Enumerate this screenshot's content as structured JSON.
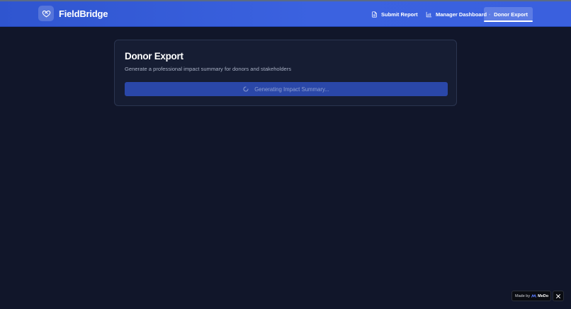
{
  "app": {
    "brand_name": "FieldBridge",
    "brand_icon": "heart-handshake-icon"
  },
  "nav": {
    "items": [
      {
        "label": "Submit Report",
        "icon": "document-icon",
        "active": false
      },
      {
        "label": "Manager Dashboard",
        "icon": "bar-chart-icon",
        "active": false
      },
      {
        "label": "Donor Export",
        "icon": "heart-handshake-icon",
        "active": true
      }
    ]
  },
  "main": {
    "title": "Donor Export",
    "subtitle": "Generate a professional impact summary for donors and stakeholders",
    "generate_button": {
      "label": "Generating Impact Summary...",
      "state": "loading",
      "icon": "spinner-icon"
    }
  },
  "badge": {
    "made_by_label": "Made by",
    "made_by_brand": "MeDo",
    "close_icon": "close-icon"
  },
  "colors": {
    "header_start": "#2f55cf",
    "header_end": "#3a60de",
    "background": "#11162a",
    "card": "#161d33",
    "button": "#2a47a8"
  }
}
